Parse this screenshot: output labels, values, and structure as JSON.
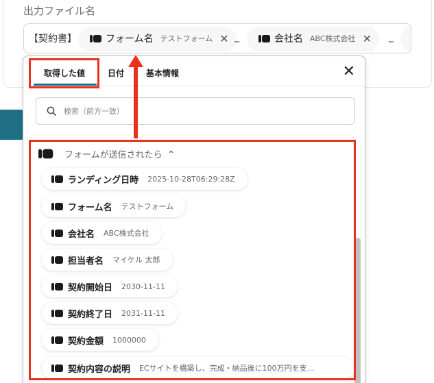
{
  "field": {
    "label": "出力ファイル名",
    "prefix": "【契約書】",
    "separator": "_",
    "chips": [
      {
        "label": "フォーム名",
        "value": "テストフォーム"
      },
      {
        "label": "会社名",
        "value": "ABC株式会社"
      }
    ]
  },
  "popup": {
    "tabs": [
      "取得した値",
      "日付",
      "基本情報"
    ],
    "search_placeholder": "検索（前方一致）",
    "group_title": "フォームが送信されたら",
    "items": [
      {
        "label": "ランディング日時",
        "value": "2025-10-28T06:29:28Z"
      },
      {
        "label": "フォーム名",
        "value": "テストフォーム"
      },
      {
        "label": "会社名",
        "value": "ABC株式会社"
      },
      {
        "label": "担当者名",
        "value": "マイケル 太郎"
      },
      {
        "label": "契約開始日",
        "value": "2030-11-11"
      },
      {
        "label": "契約終了日",
        "value": "2031-11-11"
      },
      {
        "label": "契約金額",
        "value": "1000000"
      },
      {
        "label": "契約内容の説明",
        "value": "ECサイトを構築し、完成・納品後に100万円を支..."
      }
    ]
  },
  "icons": {
    "chip_close": "close-icon",
    "popup_close": "close-icon",
    "search": "search-icon",
    "group_toggle": "chevron-up-icon",
    "app_logo": "app-logo-icon"
  },
  "colors": {
    "accent": "#1f6f85",
    "annotation": "#e8321d"
  }
}
